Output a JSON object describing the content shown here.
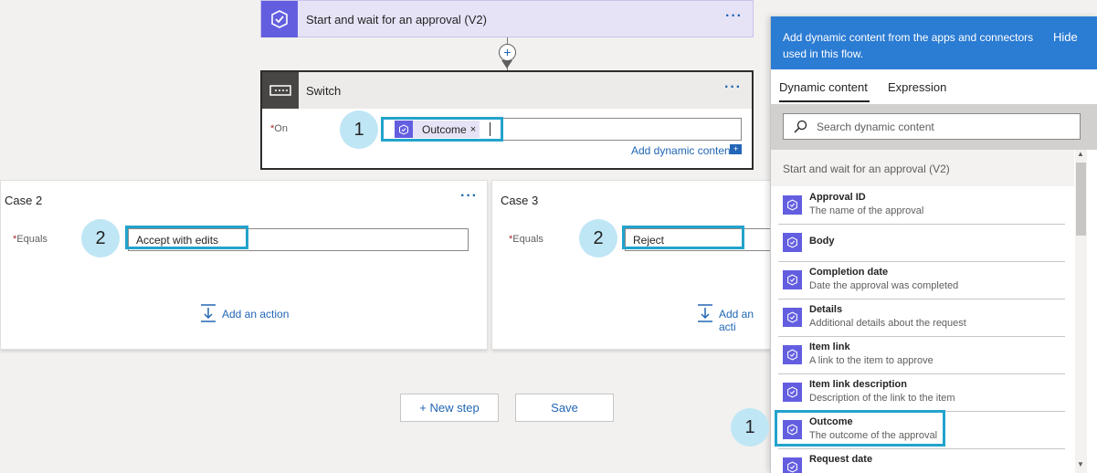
{
  "approval": {
    "title": "Start and wait for an approval (V2)",
    "menu": "···"
  },
  "switch_card": {
    "title": "Switch",
    "menu": "···",
    "on_label": "On",
    "required_mark": "*",
    "token_label": "Outcome",
    "token_remove": "×",
    "add_dynamic": "Add dynamic content",
    "add_dynamic_icon": "+"
  },
  "case2": {
    "title": "Case 2",
    "menu": "···",
    "equals_label": "Equals",
    "value": "Accept with edits",
    "add_action": "Add an action"
  },
  "case3": {
    "title": "Case 3",
    "equals_label": "Equals",
    "value": "Reject",
    "add_action": "Add an acti"
  },
  "buttons": {
    "new_step": "+ New step",
    "save": "Save"
  },
  "callouts": {
    "one": "1",
    "two": "2"
  },
  "dynamic_panel": {
    "header": "Add dynamic content from the apps and connectors used in this flow.",
    "hide": "Hide",
    "tabs": [
      "Dynamic content",
      "Expression"
    ],
    "search_placeholder": "Search dynamic content",
    "section": "Start and wait for an approval (V2)",
    "items": [
      {
        "name": "Approval ID",
        "desc": "The name of the approval"
      },
      {
        "name": "Body",
        "desc": ""
      },
      {
        "name": "Completion date",
        "desc": "Date the approval was completed"
      },
      {
        "name": "Details",
        "desc": "Additional details about the request"
      },
      {
        "name": "Item link",
        "desc": "A link to the item to approve"
      },
      {
        "name": "Item link description",
        "desc": "Description of the link to the item"
      },
      {
        "name": "Outcome",
        "desc": "The outcome of the approval"
      },
      {
        "name": "Request date",
        "desc": ""
      }
    ]
  },
  "colors": {
    "accent": "#2266b5",
    "approval_purple": "#635ee0",
    "highlight": "#22a3cc",
    "callout_bg": "#bfe6f5",
    "panel_header": "#2b7cd3"
  }
}
